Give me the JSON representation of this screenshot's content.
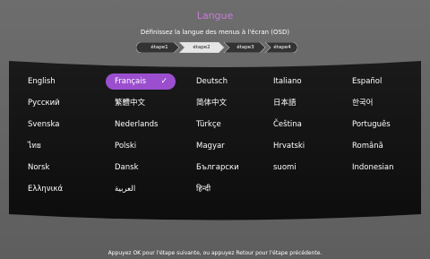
{
  "header": {
    "title": "Langue",
    "subtitle": "Définissez la langue des menus à l'écran (OSD)"
  },
  "steps": [
    "étape1",
    "étape2",
    "étape3",
    "étape4"
  ],
  "active_step": "étape2",
  "languages": [
    [
      "English",
      "Français",
      "Deutsch",
      "Italiano",
      "Español"
    ],
    [
      "Русский",
      "繁體中文",
      "简体中文",
      "日本語",
      "한국어"
    ],
    [
      "Svenska",
      "Nederlands",
      "Türkçe",
      "Čeština",
      "Português"
    ],
    [
      "ไทย",
      "Polski",
      "Magyar",
      "Hrvatski",
      "Română"
    ],
    [
      "Norsk",
      "Dansk",
      "Български",
      "suomi",
      "Indonesian"
    ],
    [
      "Ελληνικά",
      "العربية",
      "हिन्दी"
    ]
  ],
  "selected_language": "Français",
  "footer": "Appuyez OK pour l'étape suivante, ou appuyez Retour pour l'étape précédente.",
  "colors": {
    "accent": "#9b4fcf",
    "title": "#c77bdc",
    "panel": "#111111"
  }
}
